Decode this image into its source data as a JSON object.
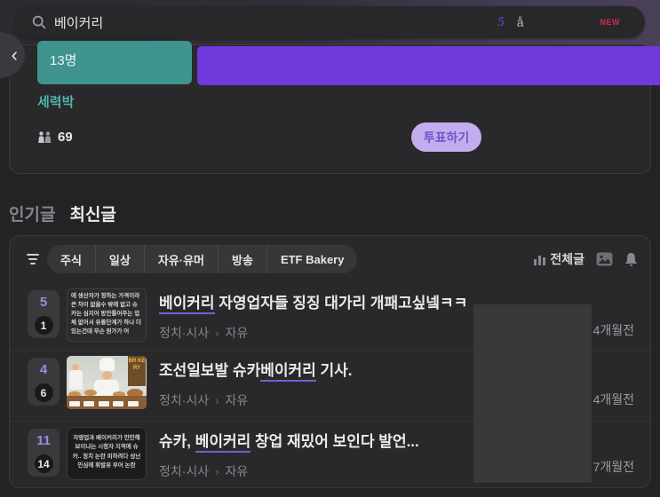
{
  "colors": {
    "page_bg": "#232325",
    "card_bg": "#29292b",
    "accent_purple": "#7138dc",
    "teal": "#3f948e",
    "teal_text": "#4fb3aa",
    "vote_btn_bg": "#c2adee",
    "vote_btn_text": "#7452cf",
    "keyword_underline": "#7a5bd4",
    "new_badge": "#cf2f47",
    "title_text": "#ebebed",
    "muted_text": "#87878c"
  },
  "search": {
    "query": "베이커리",
    "result_count": "5",
    "glyph": "å",
    "new_badge": "NEW",
    "icons": {
      "magnifier": "search-icon"
    }
  },
  "poll": {
    "prev_arrow": "‹",
    "option_count": "13명",
    "option_label": "세력박",
    "voters_count": "69",
    "vote_button": "투표하기"
  },
  "section_tabs": {
    "popular": "인기글",
    "latest": "최신글"
  },
  "board": {
    "filters": {
      "chip_0": "주식",
      "chip_1": "일상",
      "chip_2": "자유·유머",
      "chip_3": "방송",
      "chip_4": "ETF Bakery"
    },
    "view_all": "전체글",
    "posts": {
      "0": {
        "rank": "5",
        "comments": "1",
        "thumb_text": "에 생산자가 정하는 가격이라 큰 차이 없을수 밖에 없고 슈카는 심지어 방안틀어주는 업체 없어서 유통단계가 하나 더 있는건데 무슨 원가가 어",
        "title_pre": "",
        "keyword": "베이커리",
        "title_post": " 자영업자들 징징 대가리 개패고싶넼ㅋㅋ",
        "category": "정치·시사",
        "separator": "›",
        "subcategory": "자유",
        "time": "4개월전"
      },
      "1": {
        "rank": "4",
        "comments": "6",
        "thumb_sign": "BR KE RY",
        "title_pre": "조선일보발 슈카",
        "keyword": "베이커리",
        "title_post": " 기사.",
        "category": "정치·시사",
        "separator": "›",
        "subcategory": "자유",
        "time": "4개월전"
      },
      "2": {
        "rank": "11",
        "comments": "14",
        "thumb_text": "자영업과 베이커리가 만만해 보이냐는 시청자 지적에 슈카.. 정치 논란 피하려다 성난 민심에 휘발유 부어 논란",
        "title_pre": "슈카, ",
        "keyword": "베이커리",
        "title_post": " 창업 재밌어 보인다 발언...",
        "category": "정치·시사",
        "separator": "›",
        "subcategory": "자유",
        "time": "7개월전"
      }
    }
  }
}
